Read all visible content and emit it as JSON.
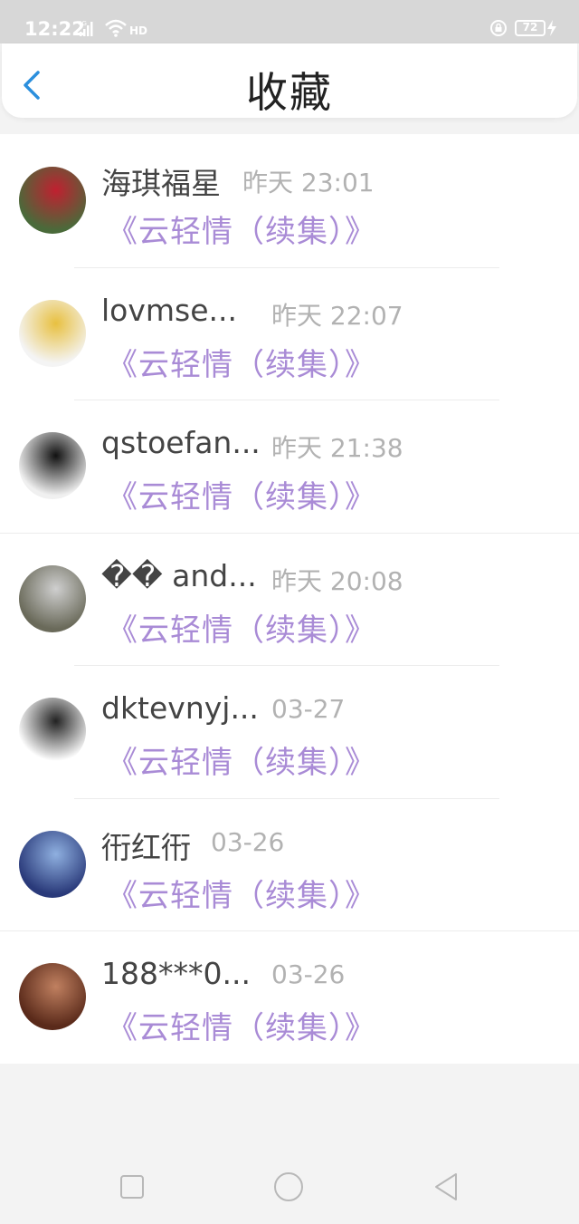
{
  "status_bar": {
    "time": "12:22",
    "network": "4G",
    "hd": "HD",
    "battery": "72"
  },
  "header": {
    "title": "收藏"
  },
  "items": [
    {
      "name": "海琪福星",
      "time": "昨天 23:01",
      "book": "《云轻情（续集）》",
      "avatar_colors": [
        "#4a6a3a",
        "#c02030"
      ]
    },
    {
      "name": "lovmse...",
      "time": "昨天 22:07",
      "book": "《云轻情（续集）》",
      "avatar_colors": [
        "#f4f4f4",
        "#e8c040"
      ]
    },
    {
      "name": "qstoefan...",
      "time": "昨天 21:38",
      "book": "《云轻情（续集）》",
      "avatar_colors": [
        "#f0f0f0",
        "#111111"
      ]
    },
    {
      "name": "�� and...",
      "time": "昨天 20:08",
      "book": "《云轻情（续集）》",
      "avatar_colors": [
        "#6a6a5a",
        "#cfcfcf"
      ]
    },
    {
      "name": "dktevnyj...",
      "time": "03-27",
      "book": "《云轻情（续集）》",
      "avatar_colors": [
        "#ffffff",
        "#222222"
      ]
    },
    {
      "name": "衎红衎",
      "time": "03-26",
      "book": "《云轻情（续集）》",
      "avatar_colors": [
        "#2a3a7a",
        "#8fb0e0"
      ]
    },
    {
      "name": "188***0...",
      "time": "03-26",
      "book": "《云轻情（续集）》",
      "avatar_colors": [
        "#5a2a1a",
        "#c08060"
      ]
    }
  ]
}
